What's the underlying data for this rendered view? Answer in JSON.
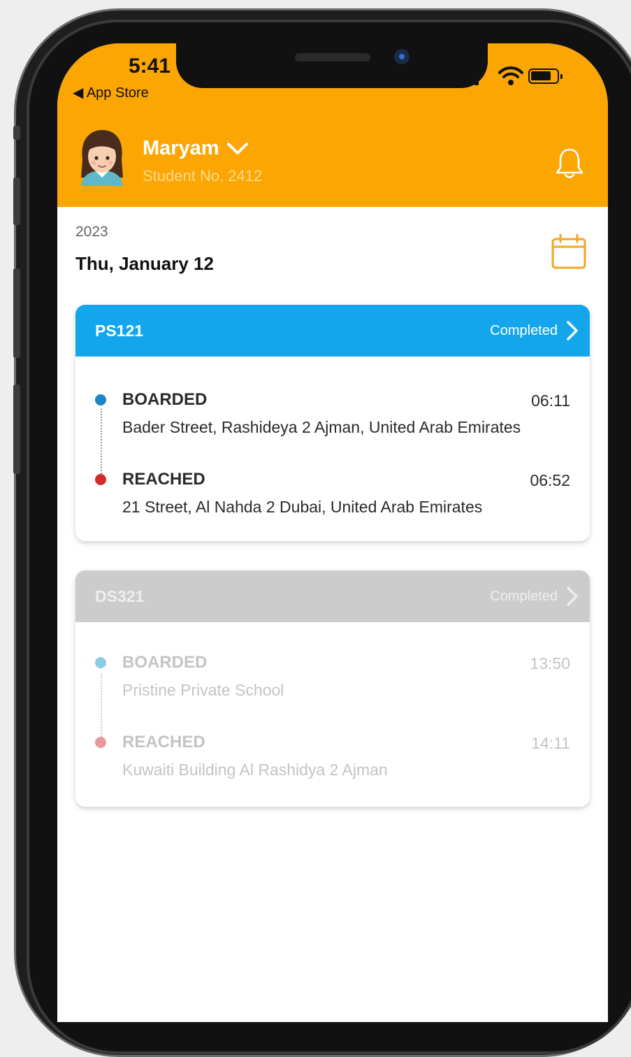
{
  "status_bar": {
    "time": "5:41",
    "back_label": "◀ App Store"
  },
  "header": {
    "student_name": "Maryam",
    "student_no": "Student No.  2412",
    "accent_color": "#fba603"
  },
  "date_section": {
    "year": "2023",
    "date": "Thu, January 12"
  },
  "trips": [
    {
      "code": "PS121",
      "status": "Completed",
      "head_color": "#13a6ec",
      "events": [
        {
          "title": "BOARDED",
          "time": "06:11",
          "address": "Bader Street, Rashideya 2 Ajman, United Arab Emirates",
          "dot_color": "#1d86c6"
        },
        {
          "title": "REACHED",
          "time": "06:52",
          "address": "21 Street, Al Nahda 2 Dubai, United Arab Emirates",
          "dot_color": "#d12b2b"
        }
      ]
    },
    {
      "code": "DS321",
      "status": "Completed",
      "head_color": "#cccccc",
      "events": [
        {
          "title": "BOARDED",
          "time": "13:50",
          "address": "Pristine Private School",
          "dot_color": "#8ccbe8"
        },
        {
          "title": "REACHED",
          "time": "14:11",
          "address": "Kuwaiti Building Al Rashidya 2 Ajman",
          "dot_color": "#e79a9a"
        }
      ]
    }
  ]
}
